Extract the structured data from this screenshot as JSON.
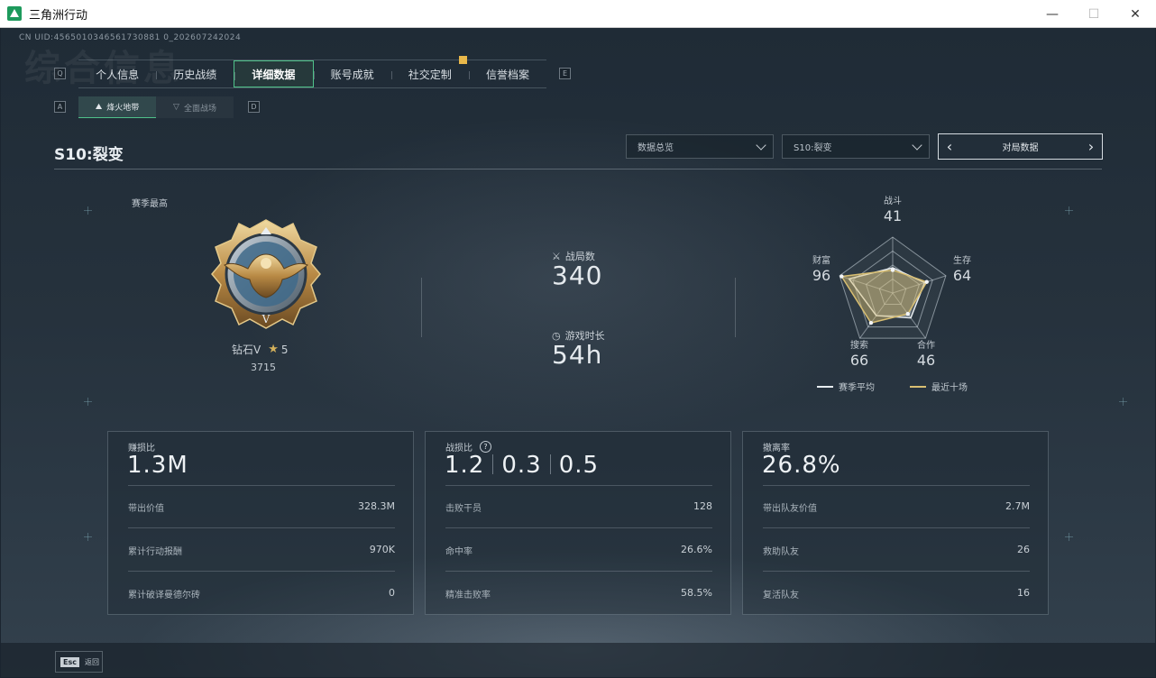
{
  "window": {
    "title": "三角洲行动",
    "minimize": "—",
    "maximize": "☐",
    "close": "✕"
  },
  "uid": "CN UID:4565010346561730881 0_202607242024",
  "watermark": "综合信息",
  "key_hints": {
    "prev_tab": "Q",
    "next_tab": "E",
    "prev_sub": "A",
    "next_sub": "D"
  },
  "tabs": [
    {
      "label": "个人信息"
    },
    {
      "label": "历史战绩"
    },
    {
      "label": "详细数据",
      "active": true
    },
    {
      "label": "账号成就"
    },
    {
      "label": "社交定制",
      "badge": true
    },
    {
      "label": "信誉档案"
    }
  ],
  "subtabs": [
    {
      "label": "烽火地带",
      "icon": "⛰",
      "active": true
    },
    {
      "label": "全面战场",
      "icon": "▽"
    }
  ],
  "season_title": "S10:裂变",
  "filters": {
    "scope": "数据总览",
    "season": "S10:裂变",
    "pager_label": "对局数据",
    "prev": "‹",
    "next": "›"
  },
  "rank": {
    "season_high_label": "赛季最高",
    "tier": "钻石V",
    "stars": "5",
    "score": "3715",
    "medal_letter": "V"
  },
  "stats": {
    "matches_label": "战局数",
    "matches_value": "340",
    "playtime_label": "游戏时长",
    "playtime_value": "54h"
  },
  "radar": {
    "axes": [
      {
        "label": "战斗",
        "value": "41"
      },
      {
        "label": "生存",
        "value": "64"
      },
      {
        "label": "合作",
        "value": "46"
      },
      {
        "label": "搜索",
        "value": "66"
      },
      {
        "label": "财富",
        "value": "96"
      }
    ],
    "season_avg": [
      0.45,
      0.6,
      0.55,
      0.5,
      0.82
    ],
    "recent_ten": [
      0.41,
      0.64,
      0.46,
      0.66,
      0.96
    ],
    "legend": [
      {
        "label": "赛季平均",
        "color": "#e8edf1"
      },
      {
        "label": "最近十场",
        "color": "#d9bf72"
      }
    ]
  },
  "cards": [
    {
      "title": "赚损比",
      "big": "1.3M",
      "rows": [
        {
          "label": "带出价值",
          "value": "328.3M"
        },
        {
          "label": "累计行动报酬",
          "value": "970K"
        },
        {
          "label": "累计破译曼德尔砖",
          "value": "0"
        }
      ]
    },
    {
      "title": "战损比",
      "help": "?",
      "big_parts": [
        "1.2",
        "0.3",
        "0.5"
      ],
      "rows": [
        {
          "label": "击败干员",
          "value": "128"
        },
        {
          "label": "命中率",
          "value": "26.6%"
        },
        {
          "label": "精准击败率",
          "value": "58.5%"
        }
      ]
    },
    {
      "title": "撤离率",
      "big": "26.8%",
      "rows": [
        {
          "label": "带出队友价值",
          "value": "2.7M"
        },
        {
          "label": "救助队友",
          "value": "26"
        },
        {
          "label": "复活队友",
          "value": "16"
        }
      ]
    }
  ],
  "footer": {
    "esc_key": "Esc",
    "esc_label": "返回"
  }
}
